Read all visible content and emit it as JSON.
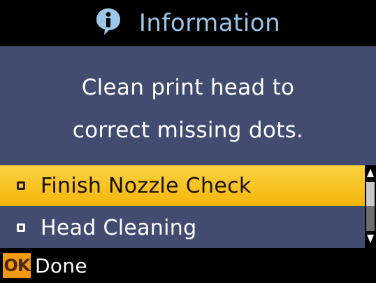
{
  "header": {
    "icon": "info-icon",
    "title": "Information"
  },
  "message": {
    "line1": "Clean print head to",
    "line2": "correct missing dots."
  },
  "options": [
    {
      "label": "Finish Nozzle Check",
      "selected": true
    },
    {
      "label": "Head Cleaning",
      "selected": false
    }
  ],
  "footer": {
    "key": "OK",
    "action": "Done"
  },
  "colors": {
    "background": "#000000",
    "panel": "#424c70",
    "highlight": "#f5b50b",
    "title_text": "#9cc6e8",
    "ok_key": "#f39a12"
  }
}
